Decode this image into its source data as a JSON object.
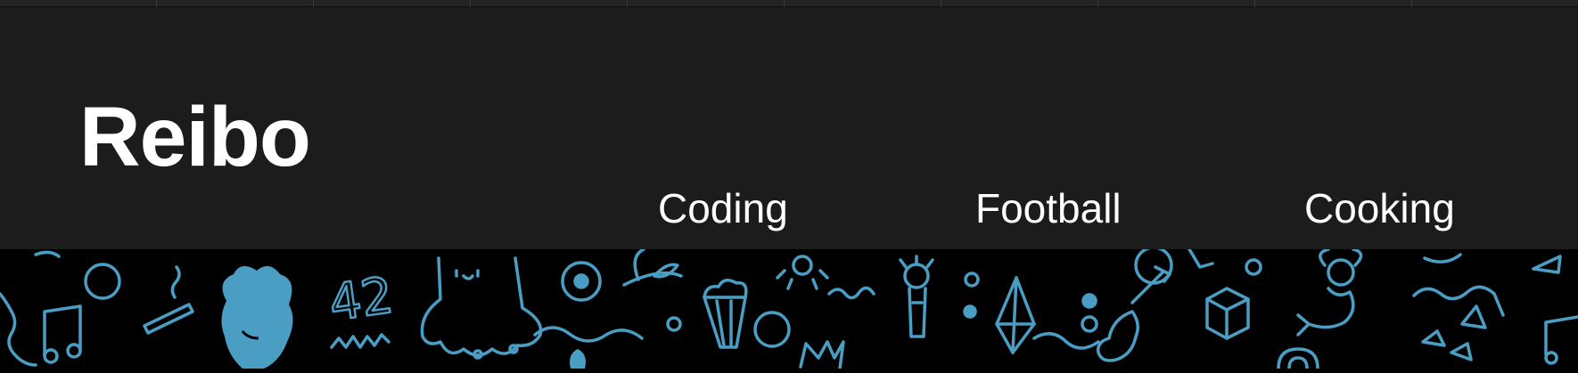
{
  "site": {
    "brand": "Reibo"
  },
  "nav": {
    "items": [
      {
        "label": "Coding"
      },
      {
        "label": "Football"
      },
      {
        "label": "Cooking"
      }
    ]
  },
  "banner": {
    "pattern_color": "#4a9ec4",
    "header_color": "#1c1c1c",
    "background_color": "#000000",
    "pattern_text": "42"
  }
}
